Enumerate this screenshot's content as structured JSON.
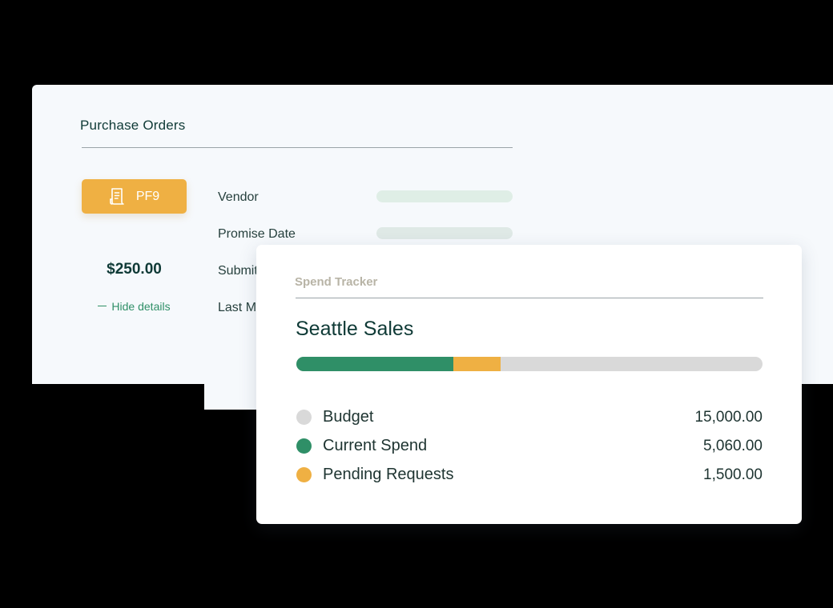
{
  "purchase_orders": {
    "title": "Purchase Orders",
    "badge": {
      "icon": "receipt-icon",
      "label": "PF9",
      "color": "#efb043"
    },
    "amount": "$250.00",
    "hide_details": "Hide details",
    "fields": [
      {
        "label": "Vendor"
      },
      {
        "label": "Promise Date"
      },
      {
        "label": "Submitted"
      },
      {
        "label": "Last Modified"
      }
    ]
  },
  "spend_tracker": {
    "label": "Spend Tracker",
    "title": "Seattle Sales",
    "progress": {
      "budget": 15000,
      "current_spend": 5060,
      "pending_requests": 1500
    },
    "legend": [
      {
        "label": "Budget",
        "value": "15,000.00",
        "color": "#d9d9d9"
      },
      {
        "label": "Current Spend",
        "value": "5,060.00",
        "color": "#2f8f67"
      },
      {
        "label": "Pending Requests",
        "value": "1,500.00",
        "color": "#efb043"
      }
    ]
  }
}
